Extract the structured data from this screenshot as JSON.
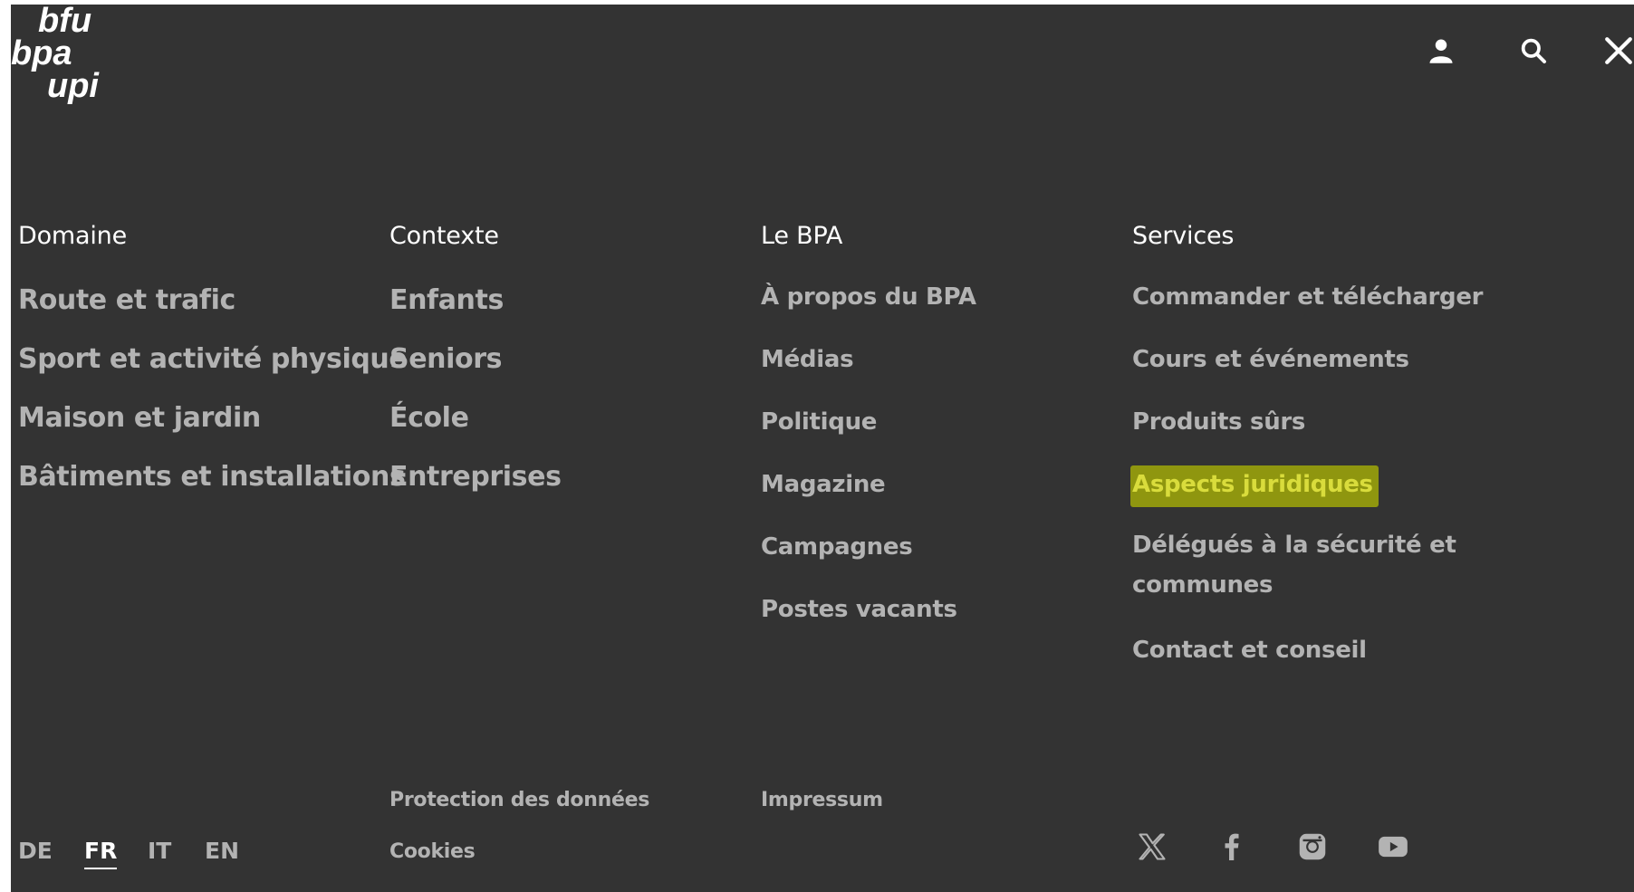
{
  "logo": {
    "alt": "bfu bpa upi",
    "line1": "bfu",
    "line2": "bpa",
    "line3": "upi"
  },
  "header": {
    "icons": [
      "user-icon",
      "search-icon",
      "close-icon"
    ]
  },
  "columns": {
    "domaine": {
      "heading": "Domaine",
      "items": [
        "Route et trafic",
        "Sport et activité physique",
        "Maison et jardin",
        "Bâtiments et installations"
      ]
    },
    "contexte": {
      "heading": "Contexte",
      "items": [
        "Enfants",
        "Seniors",
        "École",
        "Entreprises"
      ]
    },
    "bpa": {
      "heading": "Le BPA",
      "items": [
        "À propos du BPA",
        "Médias",
        "Politique",
        "Magazine",
        "Campagnes",
        "Postes vacants"
      ]
    },
    "services": {
      "heading": "Services",
      "items": [
        "Commander et télécharger",
        "Cours et événements",
        "Produits sûrs",
        "Aspects juridiques",
        "Délégués à la sécurité et communes",
        "Contact et conseil"
      ]
    }
  },
  "footer": {
    "languages": [
      "DE",
      "FR",
      "IT",
      "EN"
    ],
    "active_language": "FR",
    "links_col2": [
      "Protection des données",
      "Cookies"
    ],
    "links_col3": [
      "Impressum"
    ],
    "social": [
      "x-icon",
      "facebook-icon",
      "instagram-icon",
      "youtube-icon"
    ]
  },
  "colors": {
    "background": "#333333",
    "heading": "#ffffff",
    "link": "#b3b3b3",
    "highlight_bg": "#8f960f",
    "highlight_text": "#d9dc3c"
  }
}
